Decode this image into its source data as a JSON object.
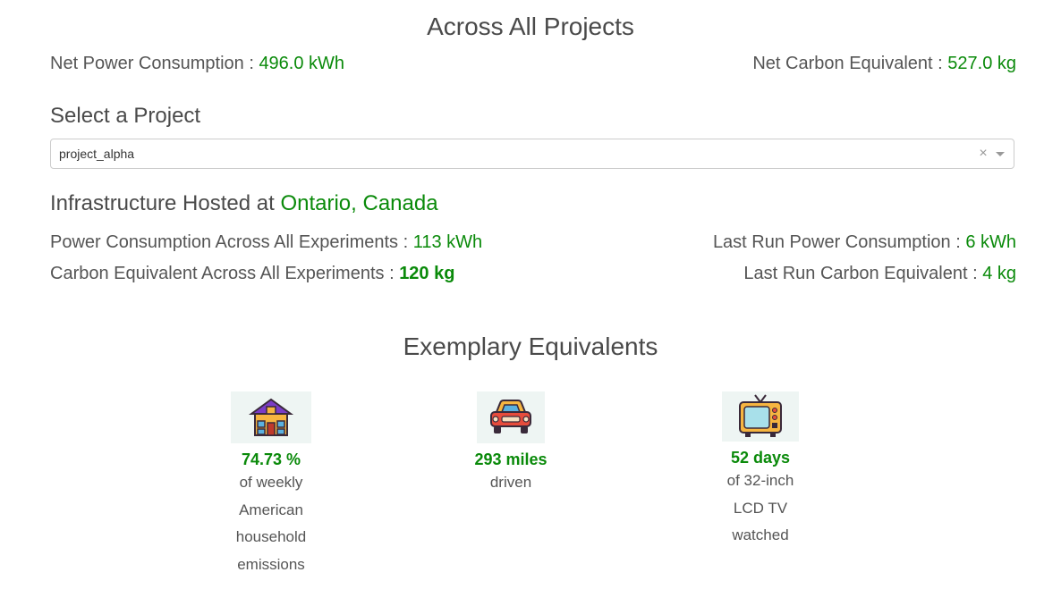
{
  "overall": {
    "title": "Across All Projects",
    "net_power_label": "Net Power Consumption : ",
    "net_power_value": "496.0 kWh",
    "net_carbon_label": "Net Carbon Equivalent : ",
    "net_carbon_value": "527.0 kg"
  },
  "project_select": {
    "title": "Select a Project",
    "selected": "project_alpha",
    "clear_symbol": "×"
  },
  "project": {
    "hosted_label": "Infrastructure Hosted at ",
    "hosted_location": "Ontario, Canada",
    "power_all_label": "Power Consumption Across All Experiments : ",
    "power_all_value": "113 kWh",
    "last_power_label": "Last Run Power Consumption : ",
    "last_power_value": "6 kWh",
    "carbon_all_label": "Carbon Equivalent Across All Experiments : ",
    "carbon_all_value": "120 kg",
    "last_carbon_label": "Last Run Carbon Equivalent : ",
    "last_carbon_value": "4 kg"
  },
  "equivalents": {
    "title": "Exemplary Equivalents",
    "items": [
      {
        "icon": "house-icon",
        "value": "74.73 %",
        "desc": [
          "of weekly",
          "American",
          "household",
          "emissions"
        ]
      },
      {
        "icon": "car-icon",
        "value": "293 miles",
        "desc": [
          "driven"
        ]
      },
      {
        "icon": "tv-icon",
        "value": "52 days",
        "desc": [
          "of 32-inch",
          "LCD TV",
          "watched"
        ]
      }
    ]
  },
  "colors": {
    "accent_green": "#0a8a0a",
    "text": "#555555",
    "border": "#cccccc"
  }
}
